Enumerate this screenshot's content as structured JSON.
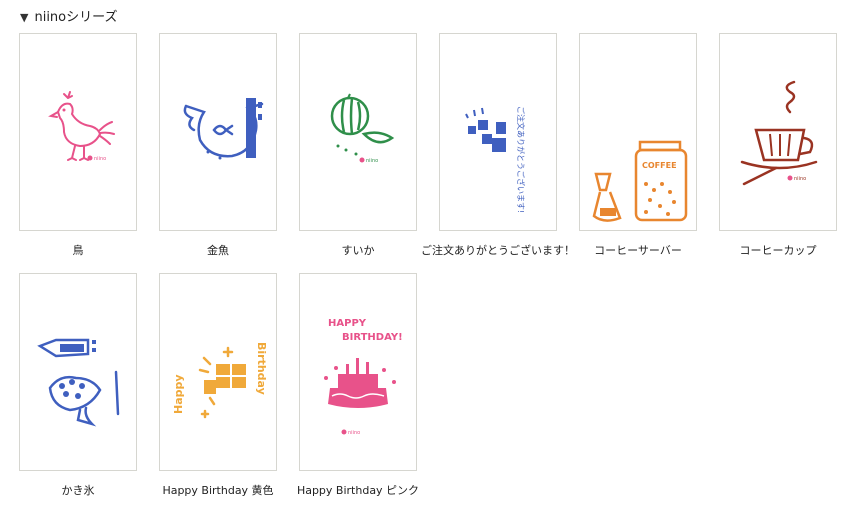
{
  "section": {
    "title": "niinoシリーズ"
  },
  "products": [
    {
      "label": "鳥"
    },
    {
      "label": "金魚"
    },
    {
      "label": "すいか"
    },
    {
      "label": "ご注文ありがとうございます！"
    },
    {
      "label": "コーヒーサーバー"
    },
    {
      "label": "コーヒーカップ"
    },
    {
      "label": "かき氷"
    },
    {
      "label": "Happy Birthday 黄色"
    },
    {
      "label": "Happy Birthday ピンク"
    }
  ],
  "card_art": {
    "thank_you_text": "ご注文ありがとうございます!",
    "coffee_text": "COFFEE",
    "birthday_lines": [
      "HAPPY",
      "BIRTHDAY!"
    ],
    "birthday_vertical_left": "Happy",
    "birthday_vertical_right": "Birthday",
    "brand_mark": "niino"
  },
  "colors": {
    "pink": "#e8528a",
    "blue": "#3f5fbf",
    "green": "#2f8f4a",
    "orange": "#e8862f",
    "brown": "#9a3322",
    "yellow": "#f0a93a"
  }
}
